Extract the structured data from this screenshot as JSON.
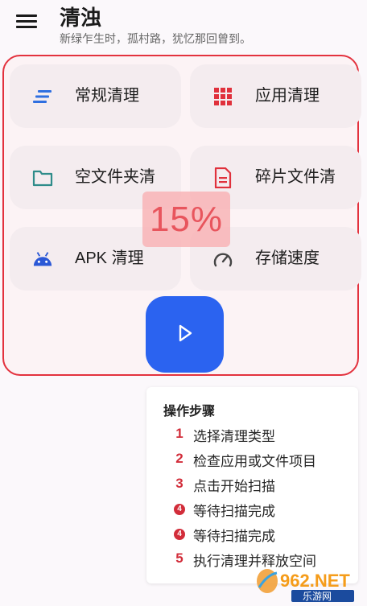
{
  "header": {
    "title": "清浊",
    "subtitle": "新绿乍生时，孤村路，犹忆那回曾到。"
  },
  "tiles": [
    {
      "label": "常规清理",
      "icon": "lines-icon",
      "color": "#2f6fe0"
    },
    {
      "label": "应用清理",
      "icon": "grid-icon",
      "color": "#e0313c"
    },
    {
      "label": "空文件夹清",
      "icon": "folder-icon",
      "color": "#2f8c8a"
    },
    {
      "label": "碎片文件清",
      "icon": "document-icon",
      "color": "#e0313c"
    },
    {
      "label": "APK 清理",
      "icon": "android-icon",
      "color": "#2b58d6"
    },
    {
      "label": "存储速度",
      "icon": "speedometer-icon",
      "color": "#444444"
    }
  ],
  "progress": {
    "text": "15%",
    "value": 0.15
  },
  "start_button": {
    "icon": "play-icon",
    "color": "#2b63f0"
  },
  "steps": {
    "title": "操作步骤",
    "items": [
      {
        "num": "1",
        "text": "选择清理类型"
      },
      {
        "num": "2",
        "text": "检查应用或文件项目"
      },
      {
        "num": "3",
        "text": "点击开始扫描"
      },
      {
        "num": "4",
        "text": "等待扫描完成"
      },
      {
        "num": "4",
        "text": "等待扫描完成"
      },
      {
        "num": "5",
        "text": "执行清理并释放空间"
      }
    ]
  },
  "watermark": {
    "logo_text": "962.NET",
    "sub_text": "乐游网"
  }
}
